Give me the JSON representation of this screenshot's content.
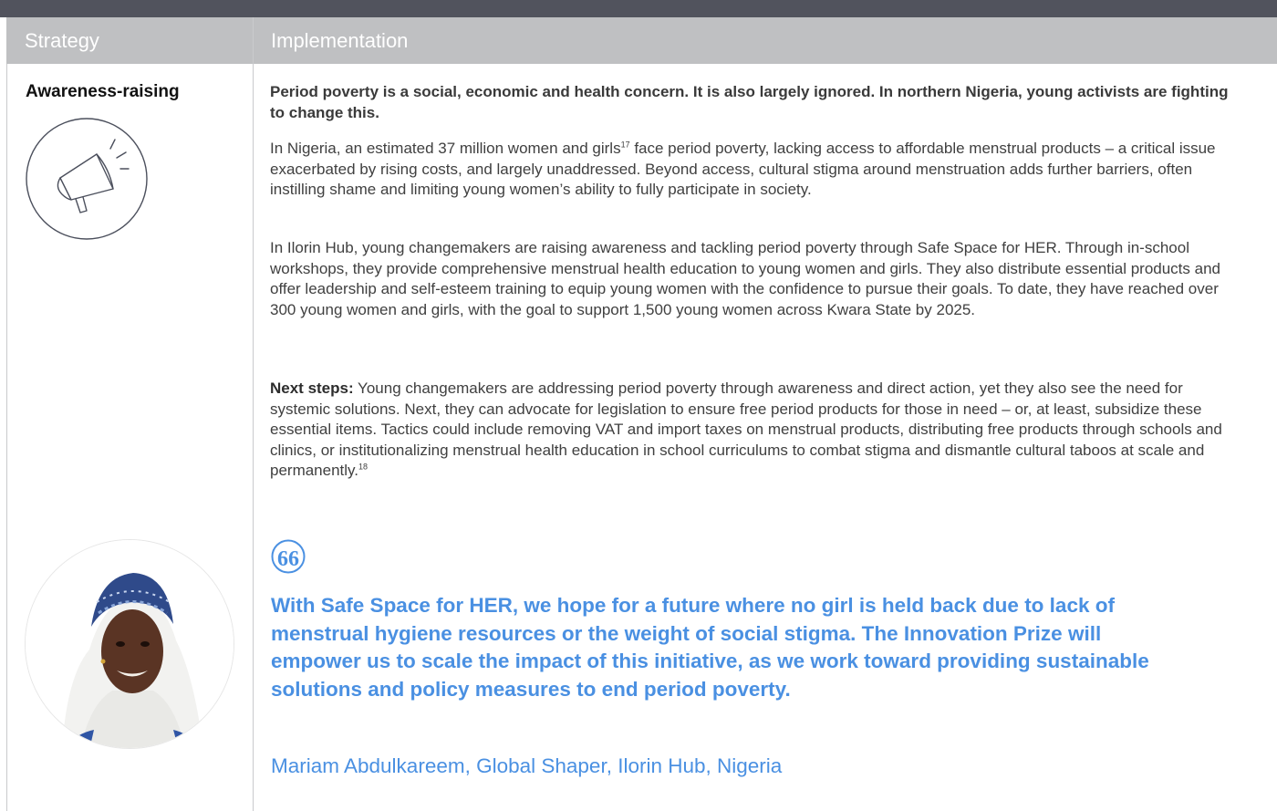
{
  "header": {
    "strategy": "Strategy",
    "implementation": "Implementation"
  },
  "strategy": {
    "label": "Awareness-raising",
    "icon": "megaphone-icon"
  },
  "implementation": {
    "lead": "Period poverty is a social, economic and health concern. It is also largely ignored. In northern Nigeria, young activists are fighting to change this.",
    "p1_before_sup": "In Nigeria, an estimated 37 million women and girls",
    "p1_sup": "17",
    "p1_after_sup": " face period poverty, lacking access to affordable menstrual products – a critical issue exacerbated by rising costs, and largely unaddressed. Beyond access, cultural stigma around menstruation adds further barriers, often instilling shame and limiting young women’s ability to fully participate in society.",
    "p2": "In Ilorin Hub, young changemakers are raising awareness and tackling period poverty through Safe Space for HER. Through in-school workshops, they provide comprehensive menstrual health education to young women and girls. They also distribute essential products and offer leadership and self-esteem training to equip young women with the confidence to pursue their goals. To date, they have reached over 300 young women and girls, with the goal to support 1,500 young women across Kwara State by 2025.",
    "next_label": "Next steps:",
    "next_text": " Young changemakers are addressing period poverty through awareness and direct action, yet they also see the need for systemic solutions. Next, they can advocate for legislation to ensure free period products for those in need – or, at least, subsidize these essential items. Tactics could include removing VAT and import taxes on menstrual products, distributing free products through schools and clinics, or institutionalizing menstrual health education in school curriculums to combat stigma and dismantle cultural taboos at scale and permanently.",
    "next_sup": "18"
  },
  "quote": {
    "mark": "66",
    "text": "With Safe Space for HER, we hope for a future where no girl is held back due to lack of menstrual hygiene resources or the weight of social stigma. The Innovation Prize will empower us to scale the impact of this initiative, as we work toward providing sustainable solutions and policy measures to end period poverty.",
    "author": "Mariam Abdulkareem, Global Shaper, Ilorin Hub, Nigeria"
  },
  "colors": {
    "accent": "#4a90e2",
    "header_bg": "#bfc0c2",
    "top_bar": "#51535d"
  }
}
